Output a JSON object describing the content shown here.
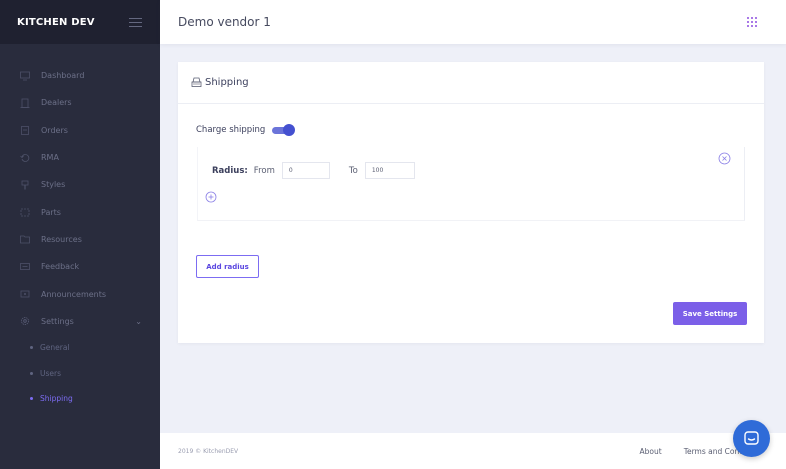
{
  "brand": {
    "name": "KITCHEN DEV"
  },
  "header": {
    "title": "Demo vendor 1"
  },
  "sidebar": {
    "items": [
      {
        "label": "Dashboard",
        "icon": "monitor-icon"
      },
      {
        "label": "Dealers",
        "icon": "building-icon"
      },
      {
        "label": "Orders",
        "icon": "clipboard-icon"
      },
      {
        "label": "RMA",
        "icon": "return-icon"
      },
      {
        "label": "Styles",
        "icon": "paint-icon"
      },
      {
        "label": "Parts",
        "icon": "box-icon"
      },
      {
        "label": "Resources",
        "icon": "folder-icon"
      },
      {
        "label": "Feedback",
        "icon": "message-icon"
      },
      {
        "label": "Announcements",
        "icon": "megaphone-icon"
      },
      {
        "label": "Settings",
        "icon": "gear-icon"
      }
    ],
    "sub_items": [
      {
        "label": "General"
      },
      {
        "label": "Users"
      },
      {
        "label": "Shipping"
      }
    ],
    "active_sub_item": "Shipping"
  },
  "card": {
    "title": "Shipping",
    "charge_shipping_label": "Charge shipping",
    "charge_shipping_enabled": true,
    "radius": {
      "label": "Radius:",
      "from_label": "From",
      "from_value": "0",
      "to_label": "To",
      "to_value": "100"
    },
    "add_radius_label": "Add radius",
    "save_label": "Save Settings"
  },
  "footer": {
    "copyright": "2019 © KitchenDEV",
    "about": "About",
    "terms": "Terms and Cond"
  },
  "colors": {
    "accent": "#7b5fe8",
    "sidebar_bg": "#292c3d",
    "toggle": "#4450d0",
    "chat": "#2f6bd8"
  }
}
